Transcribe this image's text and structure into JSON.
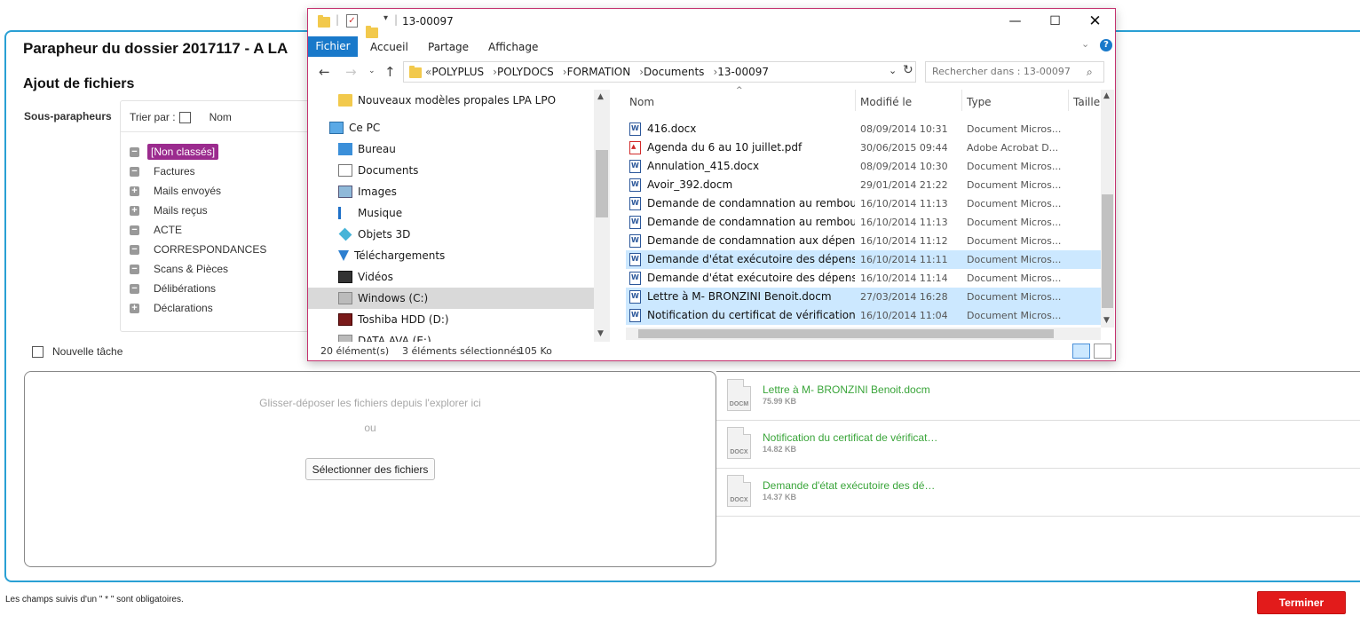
{
  "app": {
    "page_title": "Parapheur du dossier 2017117 - A LA",
    "section_title": "Ajout de fichiers",
    "sub_label": "Sous-parapheurs",
    "sort_label": "Trier par :",
    "sort_name": "Nom",
    "tree": [
      {
        "label": "[Non classés]",
        "toggle": "−",
        "selected": true
      },
      {
        "label": "Factures",
        "toggle": "−"
      },
      {
        "label": "Mails envoyés",
        "toggle": "+"
      },
      {
        "label": "Mails reçus",
        "toggle": "+"
      },
      {
        "label": "ACTE",
        "toggle": "−"
      },
      {
        "label": "CORRESPONDANCES",
        "toggle": "−"
      },
      {
        "label": "Scans & Pièces",
        "toggle": "−"
      },
      {
        "label": "Délibérations",
        "toggle": "−"
      },
      {
        "label": "Déclarations",
        "toggle": "+"
      }
    ],
    "new_task_label": "Nouvelle tâche",
    "drop_hint": "Glisser-déposer les fichiers depuis l'explorer ici",
    "drop_or": "ou",
    "select_files_label": "Sélectionner des fichiers",
    "uploaded_files": [
      {
        "name": "Lettre à M- BRONZINI Benoit.docm",
        "size": "75.99 KB",
        "ext": "DOCM"
      },
      {
        "name": "Notification du certificat de vérificat…",
        "size": "14.82 KB",
        "ext": "DOCX"
      },
      {
        "name": "Demande d'état exécutoire des dé…",
        "size": "14.37 KB",
        "ext": "DOCX"
      }
    ],
    "required_note": "Les champs suivis d'un \" * \" sont obligatoires.",
    "finish_label": "Terminer",
    "colors": {
      "accent": "#2aa0d4",
      "selected_tag": "#9b2b8e",
      "file_name": "#3aa53a",
      "finish": "#e21b1b"
    }
  },
  "explorer": {
    "title": "13-00097",
    "tabs": {
      "file": "Fichier",
      "home": "Accueil",
      "share": "Partage",
      "view": "Affichage"
    },
    "breadcrumb_prefix": "«",
    "breadcrumb": [
      "POLYPLUS",
      "POLYDOCS",
      "FORMATION",
      "Documents",
      "13-00097"
    ],
    "search_placeholder": "Rechercher dans : 13-00097",
    "nav_items": [
      {
        "label": "Nouveaux modèles propales LPA LPO",
        "icon": "folder-icon"
      },
      {
        "label": "Ce PC",
        "icon": "pc-icon"
      },
      {
        "label": "Bureau",
        "icon": "desktop-icon"
      },
      {
        "label": "Documents",
        "icon": "documents-icon"
      },
      {
        "label": "Images",
        "icon": "images-icon"
      },
      {
        "label": "Musique",
        "icon": "music-icon"
      },
      {
        "label": "Objets 3D",
        "icon": "3d-objects-icon"
      },
      {
        "label": "Téléchargements",
        "icon": "downloads-icon"
      },
      {
        "label": "Vidéos",
        "icon": "videos-icon"
      },
      {
        "label": "Windows (C:)",
        "icon": "drive-icon",
        "selected": true
      },
      {
        "label": "Toshiba HDD (D:)",
        "icon": "hdd-icon"
      },
      {
        "label": "DATA AVA (E:)",
        "icon": "drive-icon"
      }
    ],
    "columns": {
      "name": "Nom",
      "modified": "Modifié le",
      "type": "Type",
      "size": "Taille"
    },
    "files": [
      {
        "name": "416.docx",
        "date": "08/09/2014 10:31",
        "type": "Document Micros...",
        "kind": "word"
      },
      {
        "name": "Agenda du 6 au 10 juillet.pdf",
        "date": "30/06/2015 09:44",
        "type": "Adobe Acrobat D...",
        "kind": "pdf"
      },
      {
        "name": "Annulation_415.docx",
        "date": "08/09/2014 10:30",
        "type": "Document Micros...",
        "kind": "word"
      },
      {
        "name": "Avoir_392.docm",
        "date": "29/01/2014 21:22",
        "type": "Document Micros...",
        "kind": "word"
      },
      {
        "name": "Demande de condamnation au rembour...",
        "date": "16/10/2014 11:13",
        "type": "Document Micros...",
        "kind": "word"
      },
      {
        "name": "Demande de condamnation au rembour...",
        "date": "16/10/2014 11:13",
        "type": "Document Micros...",
        "kind": "word"
      },
      {
        "name": "Demande de condamnation aux dépens...",
        "date": "16/10/2014 11:12",
        "type": "Document Micros...",
        "kind": "word"
      },
      {
        "name": "Demande d'état exécutoire des dépens e...",
        "date": "16/10/2014 11:11",
        "type": "Document Micros...",
        "kind": "word",
        "selected": true
      },
      {
        "name": "Demande d'état exécutoire des dépens e...",
        "date": "16/10/2014 11:14",
        "type": "Document Micros...",
        "kind": "word"
      },
      {
        "name": "Lettre à M- BRONZINI Benoit.docm",
        "date": "27/03/2014 16:28",
        "type": "Document Micros...",
        "kind": "word",
        "selected": true
      },
      {
        "name": "Notification du certificat de vérification à...",
        "date": "16/10/2014 11:04",
        "type": "Document Micros...",
        "kind": "word",
        "selected": true
      }
    ],
    "status_count": "20 élément(s)",
    "status_selected": "3 éléments sélectionnés",
    "status_size": "105 Ko"
  }
}
